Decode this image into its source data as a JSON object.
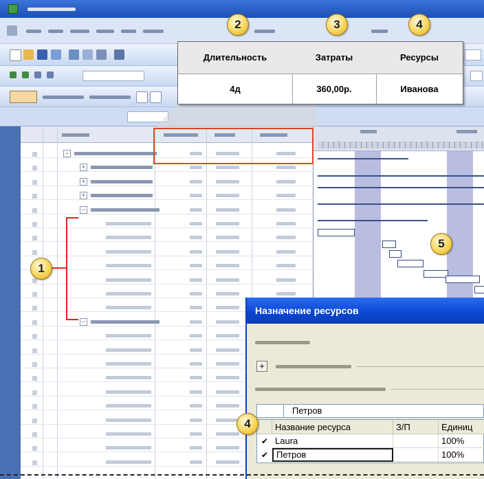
{
  "callout": {
    "headers": [
      "Длительность",
      "Затраты",
      "Ресурсы"
    ],
    "values": [
      "4д",
      "360,00р.",
      "Иванова"
    ]
  },
  "markers": [
    "1",
    "2",
    "3",
    "4",
    "5",
    "4"
  ],
  "dialog": {
    "title": "Назначение ресурсов",
    "add_button": "+",
    "resource_input": "Петров",
    "columns": [
      "Название ресурса",
      "З/П",
      "Единиц"
    ],
    "rows": [
      {
        "check": "✔",
        "name": "Laura",
        "units": "100%"
      },
      {
        "check": "✔",
        "name": "Петров",
        "units": "100%"
      }
    ]
  },
  "colors": {
    "highlight": "#e2451e",
    "bracket": "#d8291c",
    "dialog_title": "#0a45d2",
    "bubble": "#f6d55a"
  }
}
